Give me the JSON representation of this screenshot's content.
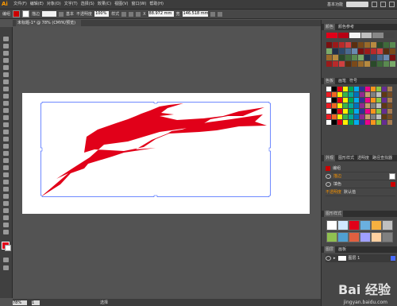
{
  "app": {
    "logo": "Ai",
    "doc_tab": "未标题-1* @ 78% (CMYK/预览)"
  },
  "menu": [
    "文件(F)",
    "编辑(E)",
    "对象(O)",
    "文字(T)",
    "选择(S)",
    "效果(C)",
    "视图(V)",
    "窗口(W)",
    "帮助(H)"
  ],
  "menu_right": {
    "workspace": "基本功能"
  },
  "control_bar": {
    "left_label": "编组",
    "stroke_label": "描边",
    "brush_label": "基本",
    "opacity_label": "不透明度",
    "opacity_value": "100%",
    "style_label": "样式",
    "x_label": "X",
    "x_value": "88.972 mm",
    "w_label": "宽",
    "w_value": "146.518 mm"
  },
  "panels": {
    "color_guide_tabs": [
      "颜色",
      "颜色参考"
    ],
    "swatch_tabs": [
      "色板",
      "画笔",
      "符号"
    ],
    "appearance_tabs": [
      "外观",
      "图形样式",
      "透明度",
      "路径查找器"
    ],
    "appearance_rows": [
      {
        "label": "编组",
        "swatch": "#cc0000"
      },
      {
        "label": "描边",
        "swatch": "#ffffff"
      },
      {
        "label": "填色",
        "swatch": "#cc0000"
      },
      {
        "label": "不透明度",
        "value": "默认值"
      }
    ],
    "graphic_styles_title": "图形样式",
    "layers_tabs": [
      "图层",
      "画板"
    ],
    "layer_name": "图层 1"
  },
  "status": {
    "zoom": "78%",
    "page": "1",
    "mode": "选择"
  },
  "watermark": {
    "brand": "Bai 经验",
    "url": "jingyan.baidu.com"
  },
  "colors": {
    "shape_fill": "#e10019",
    "ui_bg": "#535353",
    "selection": "#4a6cff"
  }
}
